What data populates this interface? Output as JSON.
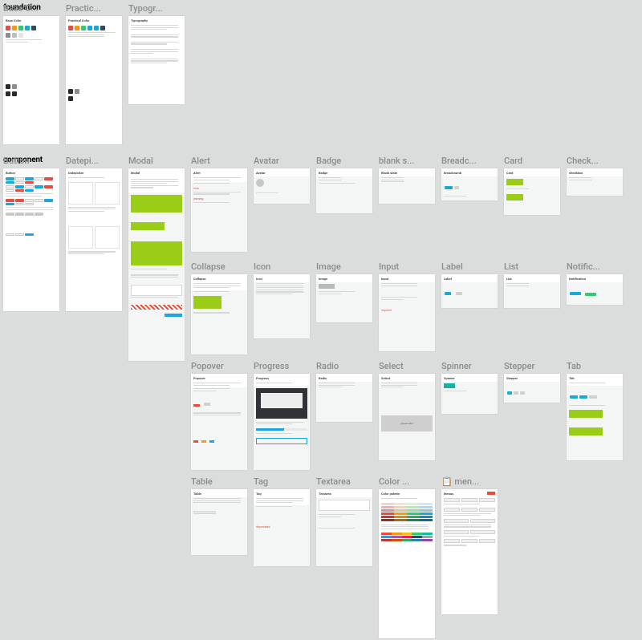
{
  "sections": {
    "foundation": "foundation",
    "component": "component"
  },
  "foundation": [
    {
      "title": "Base C...",
      "header": "Base Color"
    },
    {
      "title": "Practic...",
      "header": "Practical Color"
    },
    {
      "title": "Typogr...",
      "header": "Typography"
    }
  ],
  "component_rows": [
    [
      {
        "title": "Button",
        "header": "Button"
      },
      {
        "title": "Datepi...",
        "header": "Datepicker"
      },
      {
        "title": "Modal",
        "header": "Modal"
      },
      {
        "title": "Alert",
        "header": "Alert"
      },
      {
        "title": "Avatar",
        "header": "Avatar"
      },
      {
        "title": "Badge",
        "header": "Badge"
      },
      {
        "title": "blank s...",
        "header": "Blank state"
      },
      {
        "title": "Breadc...",
        "header": "Breadcrumb"
      },
      {
        "title": "Card",
        "header": "Card"
      },
      {
        "title": "Check...",
        "header": "checkbox"
      }
    ],
    [
      {
        "title": "Collapse",
        "header": "Collapse"
      },
      {
        "title": "Icon",
        "header": "Icon"
      },
      {
        "title": "Image",
        "header": "Image"
      },
      {
        "title": "Input",
        "header": "Input"
      },
      {
        "title": "Label",
        "header": "Label"
      },
      {
        "title": "List",
        "header": "List"
      },
      {
        "title": "Notific...",
        "header": "Notification"
      }
    ],
    [
      {
        "title": "Popover",
        "header": "Popover"
      },
      {
        "title": "Progress",
        "header": "Progress"
      },
      {
        "title": "Radio",
        "header": "Radio"
      },
      {
        "title": "Select",
        "header": "Select"
      },
      {
        "title": "Spinner",
        "header": "Spinner"
      },
      {
        "title": "Stepper",
        "header": "Stepper"
      },
      {
        "title": "Tab",
        "header": "Tab"
      }
    ],
    [
      {
        "title": "Table",
        "header": "Table"
      },
      {
        "title": "Tag",
        "header": "Tag"
      },
      {
        "title": "Textarea",
        "header": "Textarea"
      },
      {
        "title": "Color ...",
        "header": "Color palette"
      },
      {
        "title": "📋 men...",
        "header": "Menus"
      }
    ]
  ]
}
